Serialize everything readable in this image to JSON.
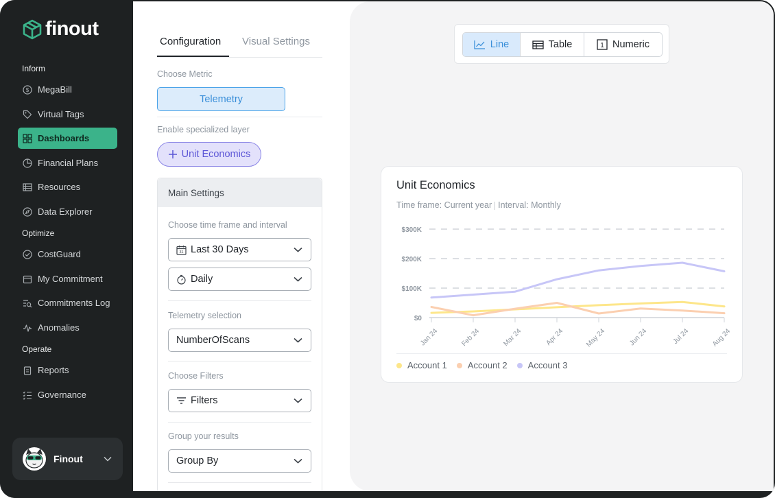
{
  "app": {
    "logo_text": "finout"
  },
  "sidebar": {
    "sections": [
      {
        "label": "Inform"
      },
      {
        "label": "Optimize"
      },
      {
        "label": "Operate"
      }
    ],
    "items": [
      {
        "label": "MegaBill",
        "icon": "dollar-icon"
      },
      {
        "label": "Virtual Tags",
        "icon": "tag-icon"
      },
      {
        "label": "Dashboards",
        "icon": "grid-icon",
        "active": true
      },
      {
        "label": "Financial Plans",
        "icon": "pie-icon"
      },
      {
        "label": "Resources",
        "icon": "list-icon"
      },
      {
        "label": "Data Explorer",
        "icon": "compass-icon"
      },
      {
        "label": "CostGuard",
        "icon": "check-circle-icon"
      },
      {
        "label": "My Commitment",
        "icon": "calendar-icon"
      },
      {
        "label": "Commitments Log",
        "icon": "search-list-icon"
      },
      {
        "label": "Anomalies",
        "icon": "pulse-icon"
      },
      {
        "label": "Reports",
        "icon": "clipboard-icon"
      },
      {
        "label": "Governance",
        "icon": "checklist-icon"
      }
    ],
    "account": {
      "name": "Finout"
    }
  },
  "config": {
    "tabs": [
      {
        "label": "Configuration",
        "active": true
      },
      {
        "label": "Visual Settings",
        "active": false
      }
    ],
    "choose_metric_label": "Choose Metric",
    "metric_button": "Telemetry",
    "specialized_layer_label": "Enable specialized layer",
    "unit_economics_button": "Unit Economics",
    "main_settings": {
      "title": "Main Settings",
      "time_label": "Choose time frame and interval",
      "time_frame": "Last 30 Days",
      "interval": "Daily",
      "telemetry_label": "Telemetry selection",
      "telemetry_value": "NumberOfScans",
      "filters_label": "Choose Filters",
      "filters_value": "Filters",
      "group_label": "Group your results",
      "group_value": "Group By"
    }
  },
  "view_toggle": {
    "options": [
      {
        "label": "Line",
        "active": true
      },
      {
        "label": "Table",
        "active": false
      },
      {
        "label": "Numeric",
        "active": false
      }
    ]
  },
  "chart_card": {
    "subtitle_time": "Time frame: Current year",
    "subtitle_interval": "Interval: Monthly"
  },
  "chart_data": {
    "type": "line",
    "title": "Unit Economics",
    "categories": [
      "Jan 24",
      "Feb 24",
      "Mar 24",
      "Apr 24",
      "May 24",
      "Jun 24",
      "Jul 24",
      "Aug 24"
    ],
    "y_ticks": [
      "$0",
      "$100K",
      "$200K",
      "$300K"
    ],
    "ylim": [
      0,
      300000
    ],
    "grid": true,
    "legend_position": "bottom-left",
    "series": [
      {
        "name": "Account 1",
        "color": "#fde68a",
        "values": [
          16000,
          21000,
          28000,
          35000,
          42000,
          48000,
          53000,
          38000
        ]
      },
      {
        "name": "Account 2",
        "color": "#fbcfb0",
        "values": [
          36000,
          8000,
          30000,
          50000,
          14000,
          31000,
          24000,
          15000
        ]
      },
      {
        "name": "Account 3",
        "color": "#c7c6f7",
        "values": [
          68000,
          78000,
          88000,
          130000,
          160000,
          175000,
          186000,
          157000
        ]
      }
    ]
  },
  "colors": {
    "accent_green": "#3bb38a",
    "accent_blue": "#3a8fd9",
    "accent_purple": "#5b55d6"
  }
}
